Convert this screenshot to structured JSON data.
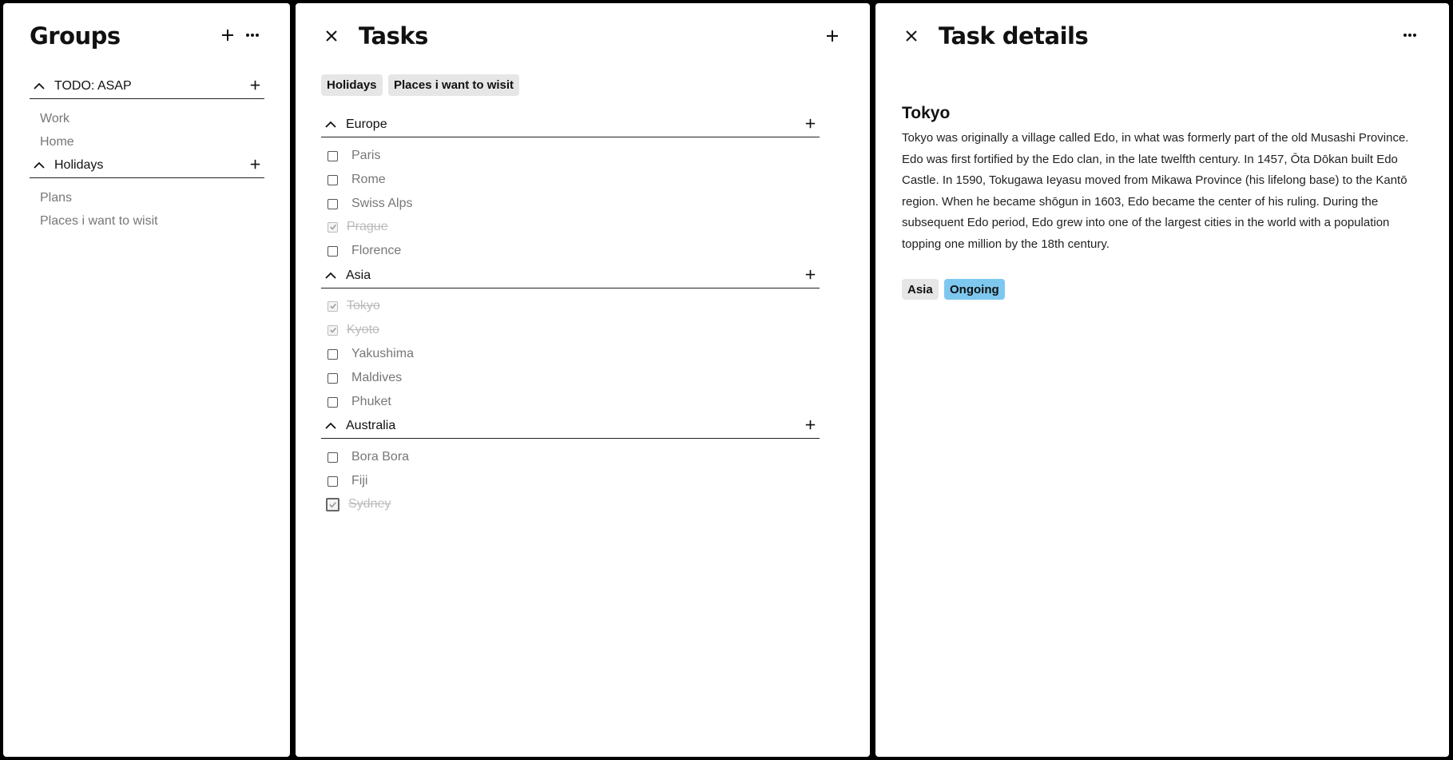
{
  "groups_panel": {
    "title": "Groups",
    "add_icon": "plus-icon",
    "more_icon": "more-horizontal-icon",
    "groups": [
      {
        "label": "TODO: ASAP",
        "items": [
          "Work",
          "Home"
        ]
      },
      {
        "label": "Holidays",
        "items": [
          "Plans",
          "Places i want to wisit"
        ]
      }
    ]
  },
  "tasks_panel": {
    "title": "Tasks",
    "close_icon": "close-icon",
    "add_icon": "plus-icon",
    "breadcrumb_chips": [
      "Holidays",
      "Places i want to wisit"
    ],
    "sections": [
      {
        "label": "Europe",
        "tasks": [
          {
            "label": "Paris",
            "done": false
          },
          {
            "label": "Rome",
            "done": false
          },
          {
            "label": "Swiss Alps",
            "done": false
          },
          {
            "label": "Prague",
            "done": true
          },
          {
            "label": "Florence",
            "done": false
          }
        ]
      },
      {
        "label": "Asia",
        "tasks": [
          {
            "label": "Tokyo",
            "done": true
          },
          {
            "label": "Kyoto",
            "done": true
          },
          {
            "label": "Yakushima",
            "done": false
          },
          {
            "label": "Maldives",
            "done": false
          },
          {
            "label": "Phuket",
            "done": false
          }
        ]
      },
      {
        "label": "Australia",
        "tasks": [
          {
            "label": "Bora Bora",
            "done": false
          },
          {
            "label": "Fiji",
            "done": false
          },
          {
            "label": "Sydney",
            "done": true
          }
        ]
      }
    ]
  },
  "details_panel": {
    "title": "Task details",
    "close_icon": "close-icon",
    "more_icon": "more-horizontal-icon",
    "task_title": "Tokyo",
    "description": "Tokyo was originally a village called Edo, in what was formerly part of the old Musashi Province. Edo was first fortified by the Edo clan, in the late twelfth century. In 1457, Ōta Dōkan built Edo Castle. In 1590, Tokugawa Ieyasu moved from Mikawa Province (his lifelong base) to the Kantō region. When he became shōgun in 1603, Edo became the center of his ruling. During the subsequent Edo period, Edo grew into one of the largest cities in the world with a population topping one million by the 18th century.",
    "tags": [
      {
        "label": "Asia",
        "color": "#e6e6e6"
      },
      {
        "label": "Ongoing",
        "color": "#7ec8f0"
      }
    ]
  }
}
